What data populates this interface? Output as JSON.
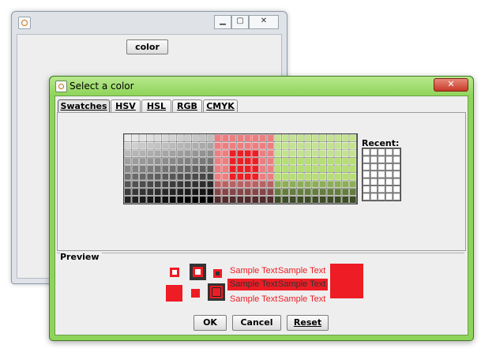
{
  "background_window": {
    "controls": [
      "▁",
      "▢",
      "✕"
    ],
    "color_button_label": "color"
  },
  "dialog": {
    "title": "Select a color",
    "close_label": "✕",
    "tabs": [
      {
        "label": "Swatches",
        "active": true
      },
      {
        "label": "HSV",
        "active": false
      },
      {
        "label": "HSL",
        "active": false
      },
      {
        "label": "RGB",
        "active": false
      },
      {
        "label": "CMYK",
        "active": false
      }
    ],
    "recent_label": "Recent:",
    "preview_label": "Preview",
    "sample_text": "Sample Text",
    "preview_color": "#ee1c24",
    "buttons": {
      "ok": "OK",
      "cancel": "Cancel",
      "reset": "Reset"
    }
  },
  "colors": {
    "accent_red": "#ee1c24",
    "window_green": "#8fd45a"
  }
}
